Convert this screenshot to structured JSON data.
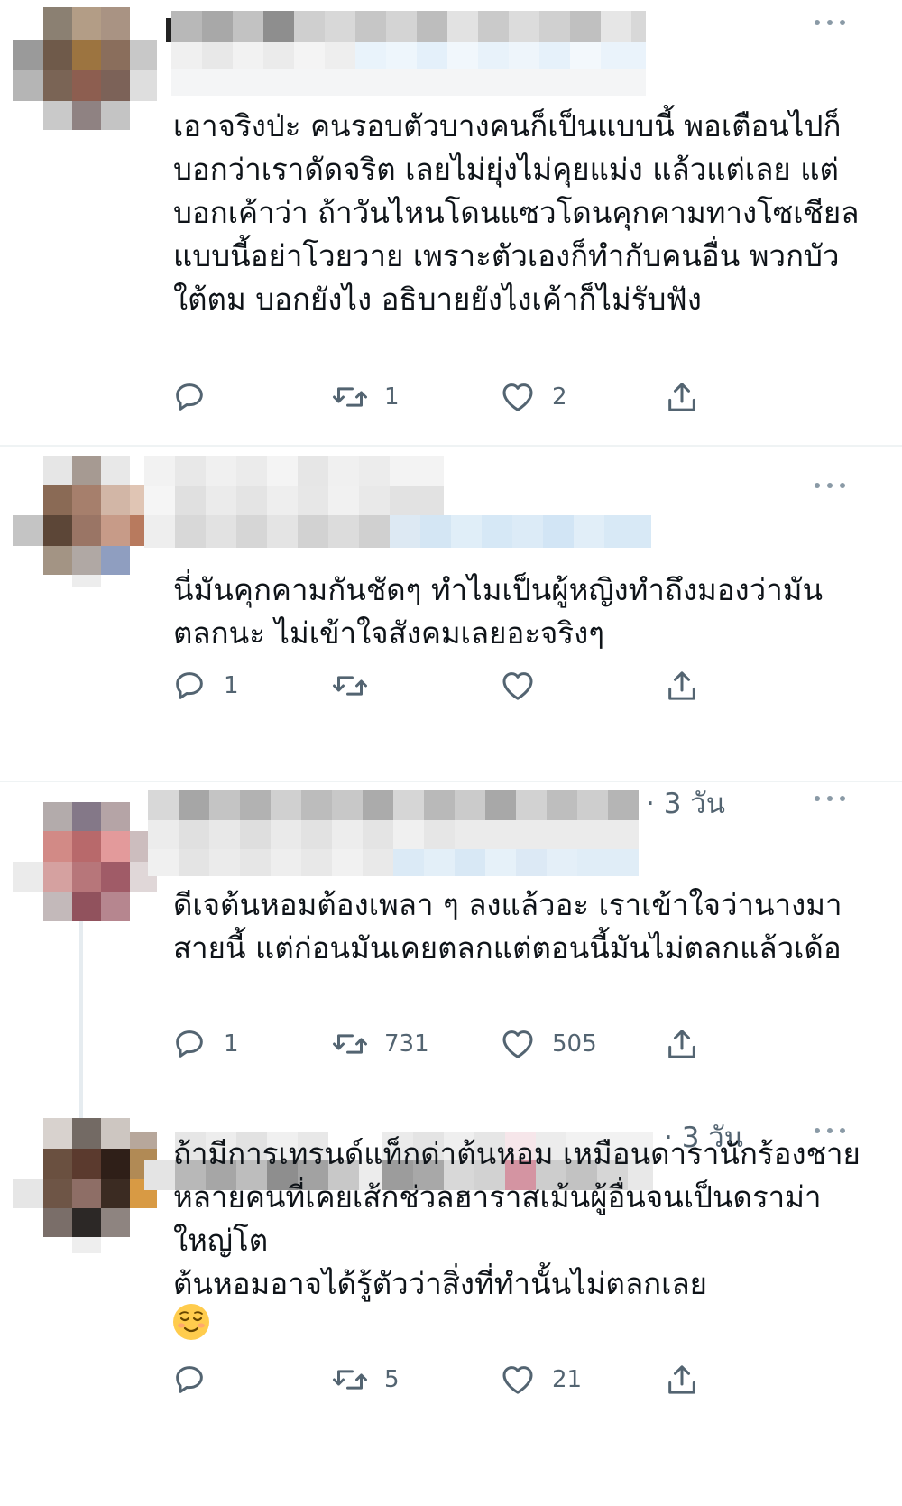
{
  "tweets": [
    {
      "time": "",
      "text": "เอาจริงป่ะ คนรอบตัวบางคนก็เป็นแบบนี้ พอเตือนไปก็บอกว่าเราดัดจริต เลยไม่ยุ่งไม่คุยแม่ง แล้วแต่เลย แต่บอกเค้าว่า ถ้าวันไหนโดนแซวโดนคุกคามทางโซเชียลแบบนี้อย่าโวยวาย เพราะตัวเองก็ทำกับคนอื่น พวกบัวใต้ตม บอกยังไง อธิบายยังไงเค้าก็ไม่รับฟัง",
      "replies": "",
      "retweets": "1",
      "likes": "2"
    },
    {
      "time": "",
      "text": "นี่มันคุกคามกันชัดๆ ทำไมเป็นผู้หญิงทำถึงมองว่ามันตลกนะ ไม่เข้าใจสังคมเลยอะจริงๆ",
      "replies": "1",
      "retweets": "",
      "likes": ""
    },
    {
      "time": "· 3 วัน",
      "text": "ดีเจต้นหอมต้องเพลา ๆ ลงแล้วอะ เราเข้าใจว่านางมาสายนี้ แต่ก่อนมันเคยตลกแต่ตอนนี้มันไม่ตลกแล้วเด้อ",
      "replies": "1",
      "retweets": "731",
      "likes": "505"
    },
    {
      "time": "· 3 วัน",
      "text": "ถ้ามีการเทรนด์แท็กด่าต้นหอม เหมือนดารานักร้องชายหลายคนที่เคยเส้กช่วลฮาราสเม้นผู้อื่นจนเป็นดราม่าใหญ่โต\nต้นหอมอาจได้รู้ตัวว่าสิ่งที่ทำนั้นไม่ตลกเลย",
      "replies": "",
      "retweets": "5",
      "likes": "21"
    }
  ],
  "icons": {
    "reply": "reply-icon",
    "retweet": "retweet-icon",
    "like": "like-icon",
    "share": "share-icon",
    "more": "more-icon",
    "emoji": "relieved-face-emoji"
  },
  "colors": {
    "text": "#0f1419",
    "muted": "#536471",
    "icon": "#536471",
    "divider": "#eff3f4",
    "background": "#ffffff"
  }
}
